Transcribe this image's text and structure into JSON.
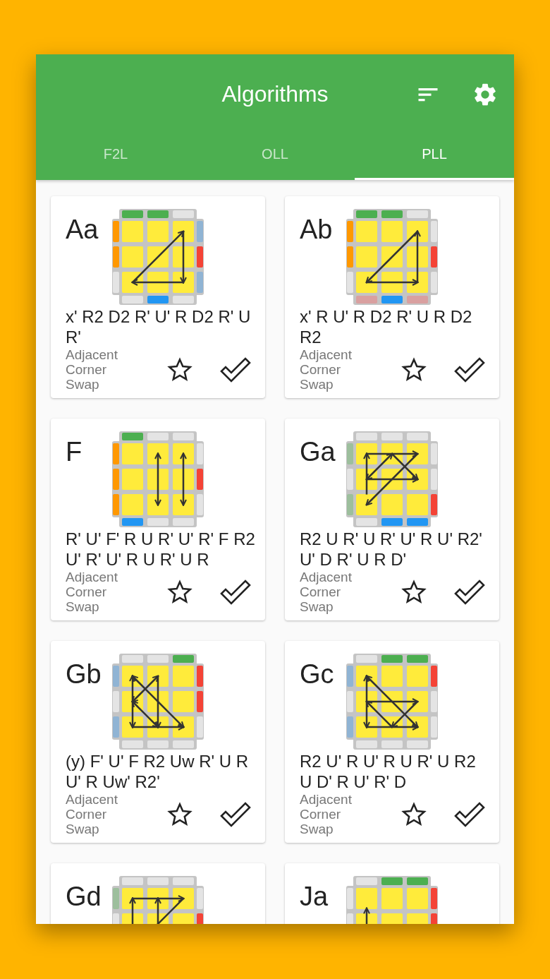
{
  "app_bar": {
    "title": "Algorithms"
  },
  "tabs": [
    {
      "label": "F2L",
      "selected": false
    },
    {
      "label": "OLL",
      "selected": false
    },
    {
      "label": "PLL",
      "selected": true
    }
  ],
  "cards": [
    {
      "name": "Aa",
      "algorithm": "x' R2 D2 R' U' R D2 R' U R'",
      "description": "Adjacent Corner Swap",
      "starred": false,
      "learned": false
    },
    {
      "name": "Ab",
      "algorithm": "x' R U' R D2 R' U R D2 R2",
      "description": "Adjacent Corner Swap",
      "starred": false,
      "learned": false
    },
    {
      "name": "F",
      "algorithm": "R' U' F' R U R' U' R' F R2 U' R' U' R U R' U R",
      "description": "Adjacent Corner Swap",
      "starred": false,
      "learned": false
    },
    {
      "name": "Ga",
      "algorithm": "R2 U R' U R' U' R U' R2' U' D R' U R D'",
      "description": "Adjacent Corner Swap",
      "starred": false,
      "learned": false
    },
    {
      "name": "Gb",
      "algorithm": "(y) F' U' F R2 Uw R' U R U' R Uw' R2'",
      "description": "Adjacent Corner Swap",
      "starred": false,
      "learned": false
    },
    {
      "name": "Gc",
      "algorithm": "R2 U' R U' R U R' U R2 U D' R U' R' D",
      "description": "Adjacent Corner Swap",
      "starred": false,
      "learned": false
    },
    {
      "name": "Gd"
    },
    {
      "name": "Ja"
    }
  ]
}
